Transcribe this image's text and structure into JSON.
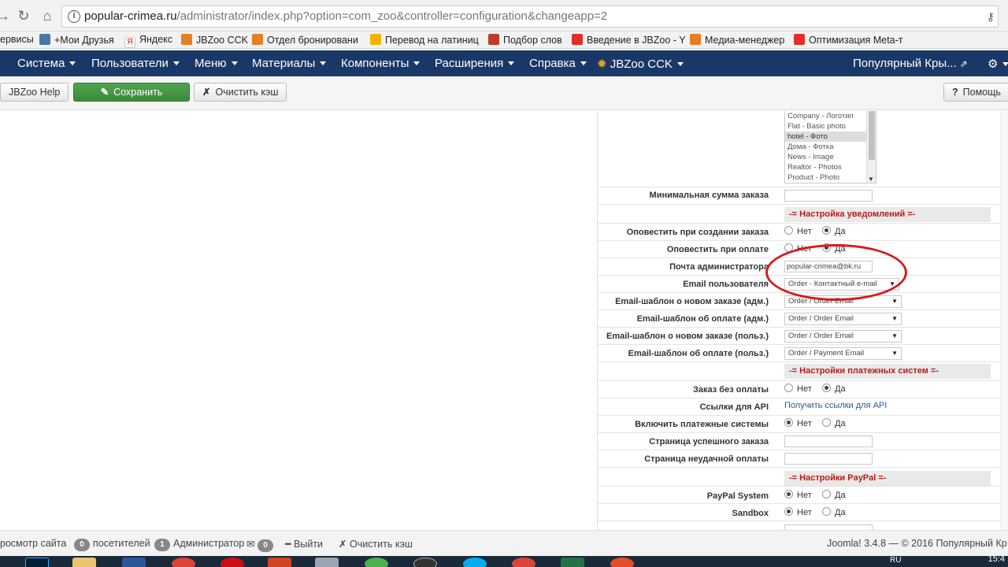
{
  "browser": {
    "url_host": "popular-crimea.ru",
    "url_path": "/administrator/index.php?option=com_zoo&controller=configuration&changeapp=2",
    "bookmarks": [
      {
        "label": "ервисы",
        "color": "#4285f4"
      },
      {
        "label": "+Мои Друзья",
        "color": "#4a76a8"
      },
      {
        "label": "Яндекс",
        "color": "#ff0000"
      },
      {
        "label": "JBZoo CCK",
        "color": "#e67e22"
      },
      {
        "label": "Отдел бронировани",
        "color": "#e67e22"
      },
      {
        "label": "Перевод на латиниц",
        "color": "#f4b400"
      },
      {
        "label": "Подбор слов",
        "color": "#c0392b"
      },
      {
        "label": "Введение в JBZoo - Y",
        "color": "#e52d27"
      },
      {
        "label": "Медиа-менеджер",
        "color": "#e67e22"
      },
      {
        "label": "Оптимизация Meta-т",
        "color": "#e52d27"
      }
    ]
  },
  "topnav": {
    "items": [
      "Система",
      "Пользователи",
      "Меню",
      "Материалы",
      "Компоненты",
      "Расширения",
      "Справка",
      "JBZoo CCK"
    ],
    "site_name": "Популярный Кры..."
  },
  "toolbar": {
    "help": "JBZoo Help",
    "save": "Сохранить",
    "clear_cache": "Очистить кэш",
    "help_right": "Помощь"
  },
  "listbox": {
    "items": [
      "Company - Логотип",
      "Flat - Basic photo",
      "hotel - Фото",
      "Дома - Фотка",
      "News - Image",
      "Realtor - Photos",
      "Product - Photo"
    ],
    "selected_index": 2
  },
  "form": {
    "min_order_label": "Минимальная сумма заказа",
    "notify_section": "-= Настройка уведомлений =-",
    "notify_create_label": "Оповестить при создании заказа",
    "notify_pay_label": "Оповестить при оплате",
    "admin_mail_label": "Почта администратора",
    "admin_mail_value": "popular-crimea@bk.ru",
    "user_email_label": "Email пользователя",
    "user_email_value": "Order - Контактный e-mail",
    "tpl_new_admin_label": "Email-шаблон о новом заказе (адм.)",
    "tpl_new_admin_value": "Order / Order Email",
    "tpl_pay_admin_label": "Email-шаблон об оплате (адм.)",
    "tpl_pay_admin_value": "Order / Order Email",
    "tpl_new_user_label": "Email-шаблон о новом заказе (польз.)",
    "tpl_new_user_value": "Order / Order Email",
    "tpl_pay_user_label": "Email-шаблон об оплате (польз.)",
    "tpl_pay_user_value": "Order / Payment Email",
    "payment_section": "-= Настройки платежных систем =-",
    "no_pay_order_label": "Заказ без оплаты",
    "api_links_label": "Ссылки для API",
    "api_links_value": "Получить ссылки для API",
    "enable_pay_label": "Включить платежные системы",
    "success_page_label": "Страница успешного заказа",
    "fail_page_label": "Страница неудачной оплаты",
    "paypal_section": "-= Настройки PayPal =-",
    "paypal_system_label": "PayPal System",
    "sandbox_label": "Sandbox",
    "no": "Нет",
    "yes": "Да"
  },
  "statusbar": {
    "preview": "росмотр сайта",
    "visitors_count": "0",
    "visitors": "посетителей",
    "admins_count": "1",
    "admins": "Администратор",
    "messages_count": "0",
    "logout": "Выйти",
    "clear_cache": "Очистить кэш",
    "copyright": "Joomla! 3.4.8 — © 2016 Популярный Кр"
  },
  "taskbar": {
    "lang": "RU",
    "clock": "15:4"
  }
}
